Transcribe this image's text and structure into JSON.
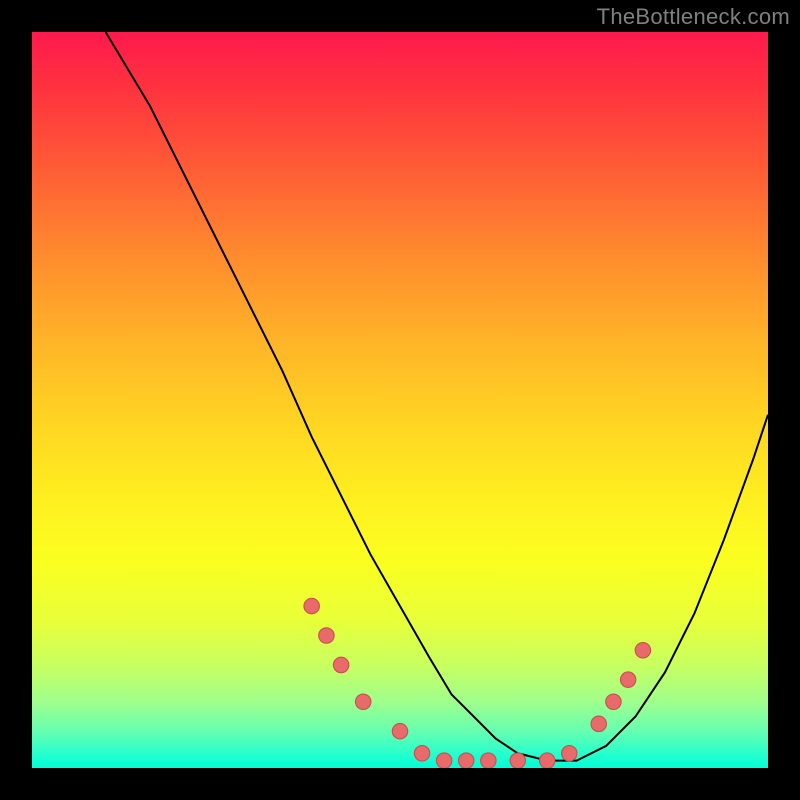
{
  "watermark": "TheBottleneck.com",
  "chart_data": {
    "type": "line",
    "title": "",
    "xlabel": "",
    "ylabel": "",
    "xlim": [
      0,
      100
    ],
    "ylim": [
      0,
      100
    ],
    "series": [
      {
        "name": "curve",
        "x": [
          10,
          16,
          22,
          28,
          34,
          38,
          42,
          46,
          50,
          54,
          57,
          60,
          63,
          66,
          70,
          74,
          78,
          82,
          86,
          90,
          94,
          98,
          100
        ],
        "y": [
          100,
          90,
          78,
          66,
          54,
          45,
          37,
          29,
          22,
          15,
          10,
          7,
          4,
          2,
          1,
          1,
          3,
          7,
          13,
          21,
          31,
          42,
          48
        ]
      }
    ],
    "markers": [
      {
        "x": 38,
        "y": 22
      },
      {
        "x": 40,
        "y": 18
      },
      {
        "x": 42,
        "y": 14
      },
      {
        "x": 45,
        "y": 9
      },
      {
        "x": 50,
        "y": 5
      },
      {
        "x": 53,
        "y": 2
      },
      {
        "x": 56,
        "y": 1
      },
      {
        "x": 59,
        "y": 1
      },
      {
        "x": 62,
        "y": 1
      },
      {
        "x": 66,
        "y": 1
      },
      {
        "x": 70,
        "y": 1
      },
      {
        "x": 73,
        "y": 2
      },
      {
        "x": 77,
        "y": 6
      },
      {
        "x": 79,
        "y": 9
      },
      {
        "x": 81,
        "y": 12
      },
      {
        "x": 83,
        "y": 16
      }
    ],
    "colors": {
      "curve": "#000000",
      "marker_fill": "#e86a6a",
      "marker_stroke": "#c94f4f",
      "gradient_top": "#ff1a4d",
      "gradient_bottom": "#00ffd8"
    }
  }
}
